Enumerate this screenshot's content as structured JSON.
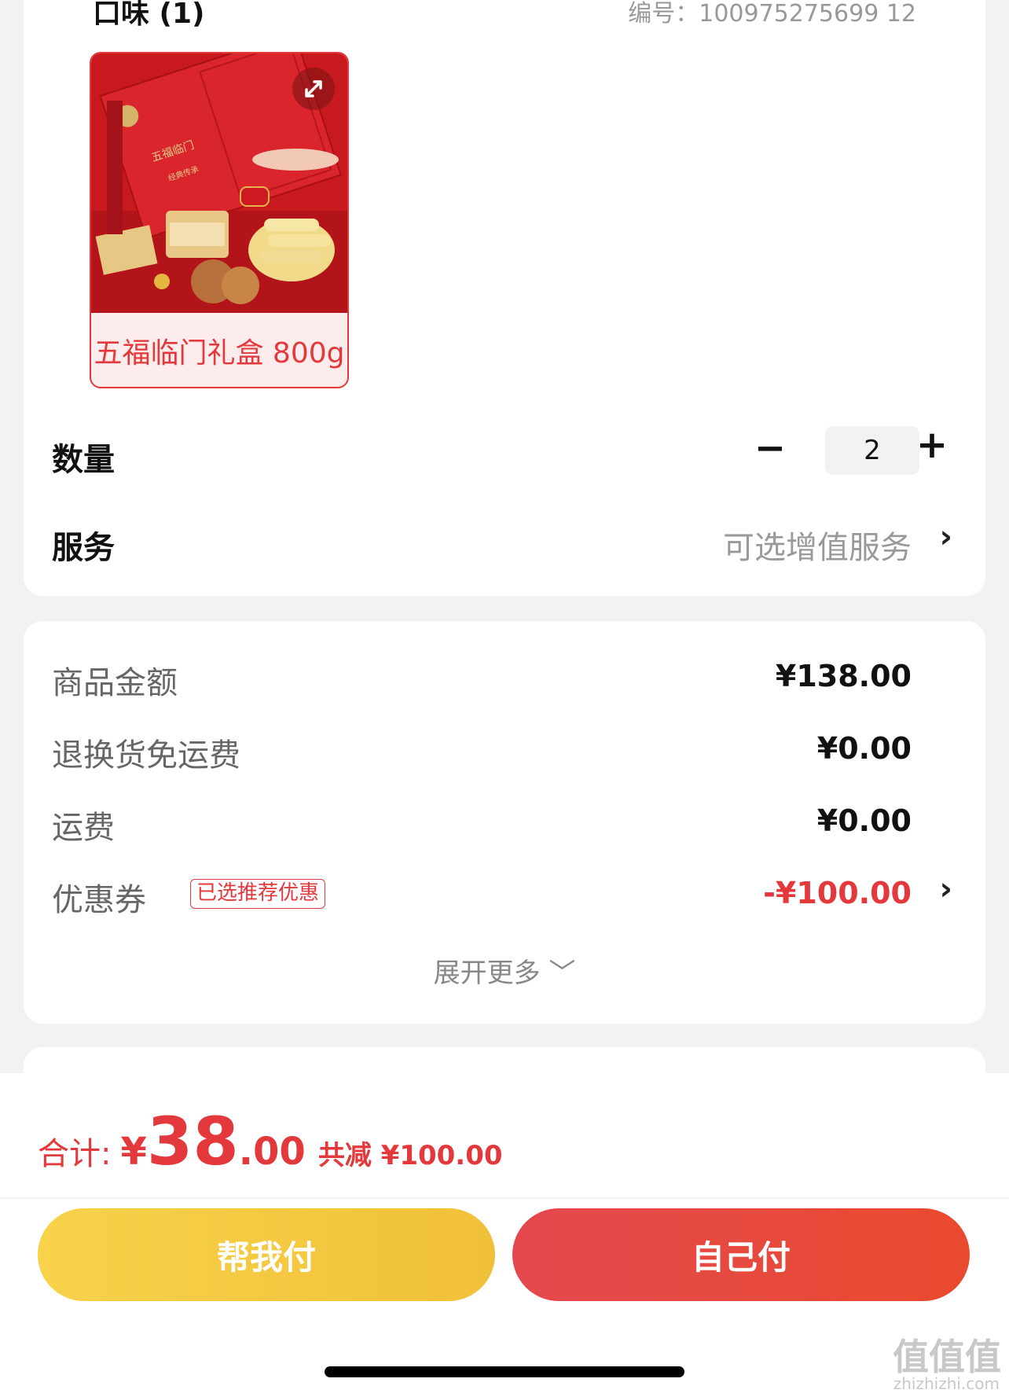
{
  "spec": {
    "title": "口味 (1)",
    "code": "编号：100975275699 12"
  },
  "product": {
    "name": "五福临门礼盒 800g",
    "box_text_main": "五福临门",
    "box_text_sub": "经典传承"
  },
  "quantity": {
    "label": "数量",
    "value": "2",
    "minus": "−",
    "plus": "+"
  },
  "service": {
    "label": "服务",
    "value": "可选增值服务",
    "chevron": "›"
  },
  "fees": {
    "goods_amount_label": "商品金额",
    "goods_amount_value": "¥138.00",
    "return_shipping_label": "退换货免运费",
    "return_shipping_value": "¥0.00",
    "shipping_label": "运费",
    "shipping_value": "¥0.00",
    "coupon_label": "优惠券",
    "coupon_tag": "已选推荐优惠",
    "coupon_value": "-¥100.00",
    "coupon_chevron": "›",
    "expand_more": "展开更多 ﹀"
  },
  "total": {
    "label": "合计:",
    "currency": "¥",
    "integer": "38",
    "decimal": ".00",
    "saved": "共减 ¥100.00"
  },
  "buttons": {
    "help_pay": "帮我付",
    "self_pay": "自己付"
  },
  "watermark": {
    "main": "值值值",
    "sub": "zhizhizhi.com"
  },
  "colors": {
    "accent_red": "#e4393c",
    "help_pay_yellow": "#f3c83f",
    "self_pay_red": "#e6473e"
  }
}
